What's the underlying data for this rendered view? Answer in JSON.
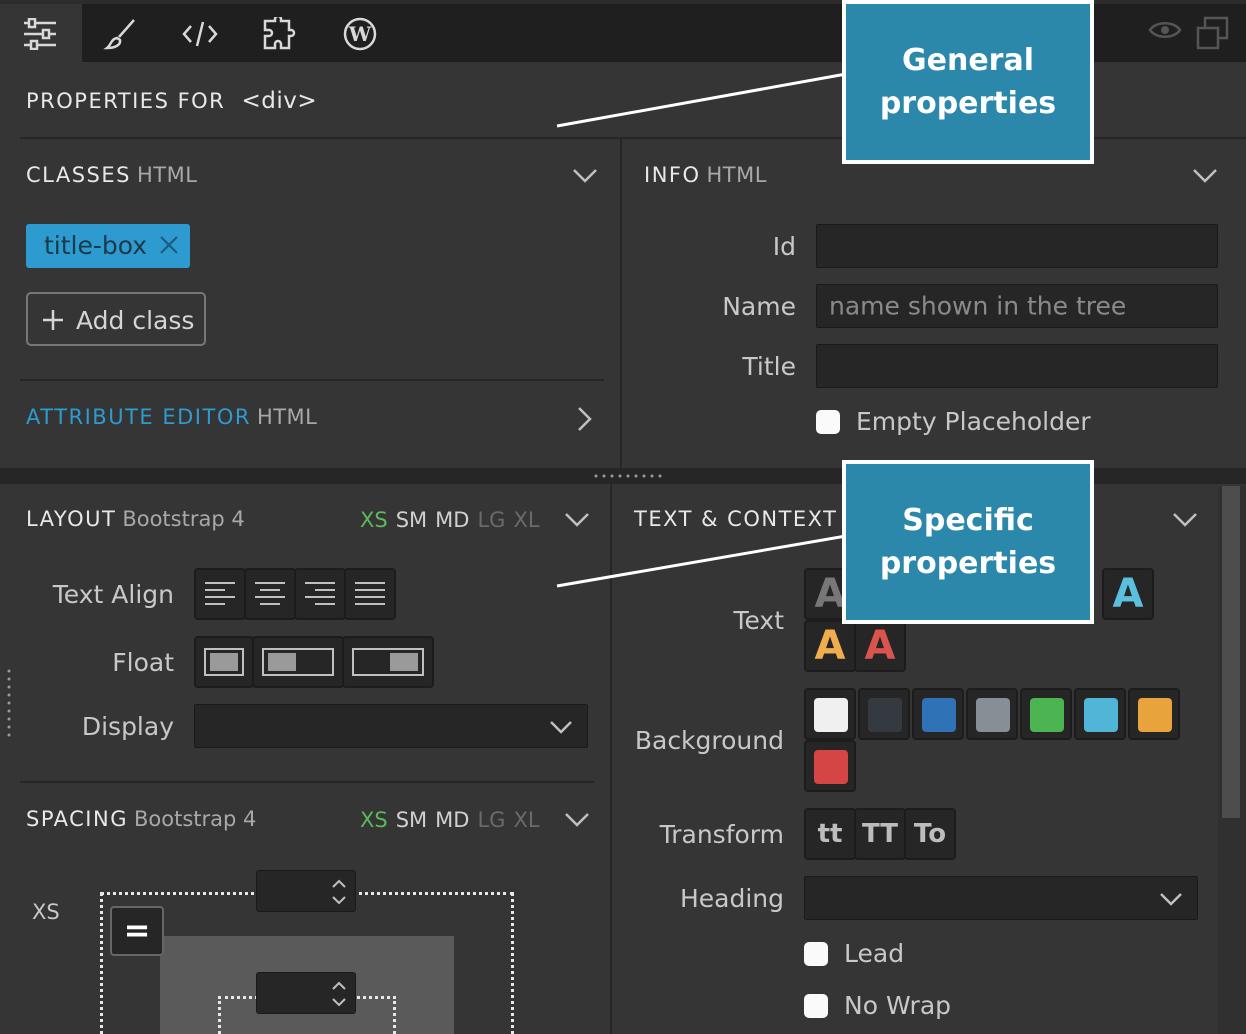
{
  "toolbar": {
    "icons": [
      "properties-sliders-icon",
      "brush-icon",
      "code-icon",
      "puzzle-icon",
      "wordpress-icon"
    ],
    "right_icons": [
      "eye-icon",
      "duplicate-window-icon"
    ]
  },
  "header": {
    "title": "PROPERTIES FOR",
    "element": "<div>"
  },
  "classes": {
    "title": "CLASSES",
    "sub": "HTML",
    "tag": "title-box",
    "add_label": "Add class"
  },
  "attribute_editor": {
    "title": "ATTRIBUTE EDITOR",
    "sub": "HTML"
  },
  "info": {
    "title": "INFO",
    "sub": "HTML",
    "id_label": "Id",
    "name_label": "Name",
    "name_placeholder": "name shown in the tree",
    "title_label": "Title",
    "empty_placeholder_label": "Empty Placeholder"
  },
  "layout": {
    "title": "LAYOUT",
    "sub": "Bootstrap 4",
    "breakpoints": [
      "XS",
      "SM",
      "MD",
      "LG",
      "XL"
    ],
    "text_align_label": "Text Align",
    "float_label": "Float",
    "display_label": "Display"
  },
  "spacing": {
    "title": "SPACING",
    "sub": "Bootstrap 4",
    "breakpoints": [
      "XS",
      "SM",
      "MD",
      "LG",
      "XL"
    ],
    "xs_label": "XS",
    "link_button": "="
  },
  "text_context": {
    "title": "TEXT & CONTEXT",
    "text_label": "Text",
    "text_letter": "A",
    "background_label": "Background",
    "transform_label": "Transform",
    "transform_options": [
      "tt",
      "TT",
      "To"
    ],
    "heading_label": "Heading",
    "lead_label": "Lead",
    "nowrap_label": "No Wrap"
  },
  "callouts": {
    "general": "General properties",
    "specific": "Specific properties"
  },
  "colors": {
    "accent": "#2d9bd0",
    "callout_bg": "#2b88ab",
    "bp_active": "#5cb85c",
    "text_variant_grey": "#777777",
    "text_variant_blue": "#5bc0de",
    "text_variant_orange": "#f0ad4e",
    "text_variant_red": "#d9534f",
    "backgrounds": [
      "#f0f0f0",
      "#343a40",
      "#2f72b6",
      "#868e96",
      "#4cb552",
      "#50b5d6",
      "#e8a33d",
      "#d64545"
    ]
  }
}
